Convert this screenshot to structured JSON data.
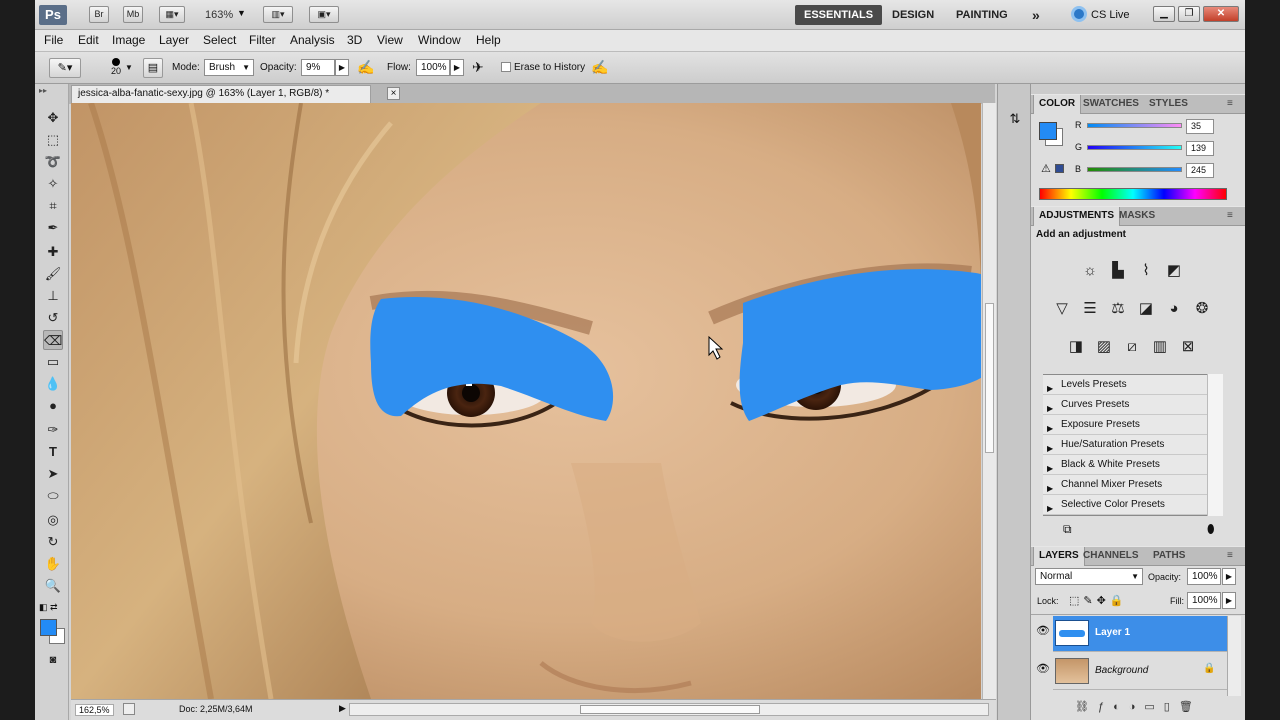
{
  "appbar": {
    "logo": "Ps",
    "bridge": "Br",
    "minibridge": "Mb",
    "zoom": "163%",
    "workspaces": [
      "ESSENTIALS",
      "DESIGN",
      "PAINTING"
    ],
    "more": "»",
    "cslive": "CS Live"
  },
  "menu": [
    "File",
    "Edit",
    "Image",
    "Layer",
    "Select",
    "Filter",
    "Analysis",
    "3D",
    "View",
    "Window",
    "Help"
  ],
  "options": {
    "brush_size": "20",
    "mode_label": "Mode:",
    "mode_value": "Brush",
    "opacity_label": "Opacity:",
    "opacity_value": "9%",
    "flow_label": "Flow:",
    "flow_value": "100%",
    "erase_label": "Erase to History"
  },
  "document": {
    "tab_title": "jessica-alba-fanatic-sexy.jpg @ 163% (Layer 1, RGB/8) *",
    "close": "×",
    "status_zoom": "162,5%",
    "status_doc": "Doc: 2,25M/3,64M"
  },
  "color_panel": {
    "tabs": [
      "COLOR",
      "SWATCHES",
      "STYLES"
    ],
    "r_label": "R",
    "g_label": "G",
    "b_label": "B",
    "r": "35",
    "g": "139",
    "b": "245",
    "foreground": "#238bf5"
  },
  "adjustments_panel": {
    "tabs": [
      "ADJUSTMENTS",
      "MASKS"
    ],
    "heading": "Add an adjustment",
    "presets": [
      "Levels Presets",
      "Curves Presets",
      "Exposure Presets",
      "Hue/Saturation Presets",
      "Black & White Presets",
      "Channel Mixer Presets",
      "Selective Color Presets"
    ]
  },
  "layers_panel": {
    "tabs": [
      "LAYERS",
      "CHANNELS",
      "PATHS"
    ],
    "blend_mode": "Normal",
    "opacity_label": "Opacity:",
    "opacity_value": "100%",
    "lock_label": "Lock:",
    "fill_label": "Fill:",
    "fill_value": "100%",
    "layers": [
      {
        "name": "Layer 1",
        "selected": true
      },
      {
        "name": "Background",
        "selected": false
      }
    ]
  },
  "colors": {
    "paint_blue": "#2f8ff0",
    "selected_layer": "#3d8ee8"
  }
}
